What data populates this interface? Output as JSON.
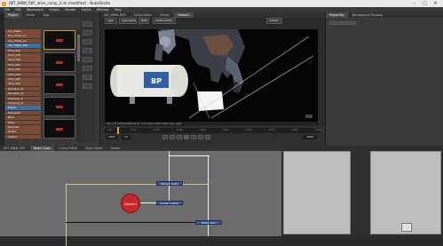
{
  "window": {
    "title": "AKT_WBW_RBF_alien_comp_2.nk (modified) - NukeStudio",
    "controls": [
      "–",
      "▢",
      "✕"
    ]
  },
  "menu": [
    "File",
    "Edit",
    "Workspace",
    "Viewer",
    "Render",
    "Cache",
    "Window",
    "Help"
  ],
  "project_panel": {
    "tabs": [
      "Project",
      "Media",
      "Tags"
    ],
    "bins": [
      "ALL_Tasks",
      "ALL_Shots_v1",
      "ALL_Shots_v2",
      "AKT_WBW_RBF",
      "Shot_020",
      "Shot_030",
      "Shot_040",
      "Shot_050",
      "Shot_060",
      "Shot_070",
      "Shot_080",
      "Shot_090",
      "Renders_v1",
      "Renders_v2",
      "Precomp_A",
      "Precomp_B",
      "Plates",
      "Elements",
      "Roto",
      "Paint",
      "Denoise",
      "Grade",
      "Output"
    ],
    "thumbnails": 5
  },
  "viewer_panel": {
    "tabs": [
      "AKT_WBW_RBF",
      "Script Editor",
      "Viewer",
      "Viewer1"
    ],
    "toolbar": [
      "rgba",
      "rgba.alpha",
      "RGB",
      "sRGB (ACES)",
      "default"
    ],
    "tank_text": "BP",
    "info_bar": "AKT_03 1920x1080 bbox: 0 0 1920 1080 channels: rgba"
  },
  "timeline": {
    "frame": "1001",
    "fps": "24",
    "end_frame": "1090",
    "ticks": [
      "1001",
      "1010",
      "1020",
      "1030",
      "1040",
      "1050",
      "1060",
      "1070",
      "1080",
      "1090"
    ]
  },
  "properties_panel": {
    "tabs": [
      "Properties",
      "Background Renders"
    ]
  },
  "node_graph": {
    "tabs": [
      "AKT_WBW_RBF",
      "Node Graph",
      "Curve Editor",
      "Dope Sheet",
      "Viewer"
    ],
    "nodes": [
      {
        "label": "Merge1 (over)"
      },
      {
        "label": "Grade1 (mask)"
      },
      {
        "label": "Write1 (exr)"
      }
    ],
    "camera_label": "Camera1"
  },
  "colors": {
    "bin_orange": "#7a4c36",
    "bin_selected": "#3d6fa0",
    "node_blue": "#3f5b97",
    "camera_red": "#c8262a",
    "graph_bg": "#6c6c6c"
  }
}
